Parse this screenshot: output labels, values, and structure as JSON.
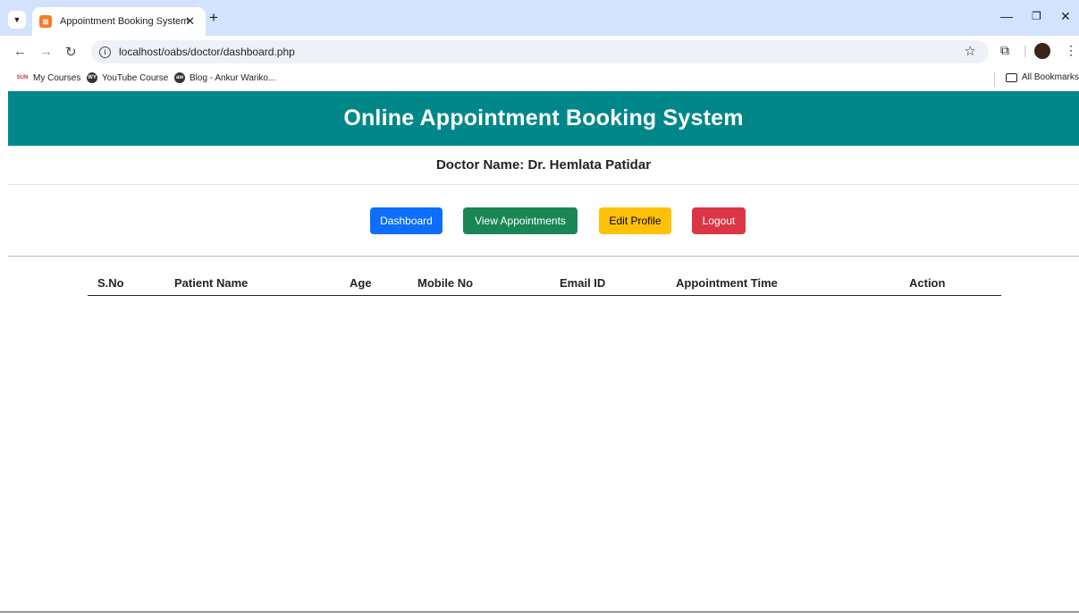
{
  "browser": {
    "tab_title": "Appointment Booking System",
    "tab_close": "✕",
    "new_tab": "+",
    "url": "localhost/oabs/doctor/dashboard.php",
    "bookmarks": [
      {
        "label": "My Courses",
        "icon": "SUN"
      },
      {
        "label": "YouTube Course",
        "icon": "WY"
      },
      {
        "label": "Blog - Ankur Wariko...",
        "icon": "aw"
      }
    ],
    "all_bookmarks": "All Bookmarks"
  },
  "header": {
    "title": "Online Appointment Booking System"
  },
  "doctor": {
    "label": "Doctor Name: Dr. Hemlata Patidar"
  },
  "nav": {
    "dashboard": "Dashboard",
    "view_appointments": "View Appointments",
    "edit_profile": "Edit Profile",
    "logout": "Logout"
  },
  "table": {
    "columns": [
      "S.No",
      "Patient Name",
      "Age",
      "Mobile No",
      "Email ID",
      "Appointment Time",
      "Action"
    ]
  },
  "colors": {
    "header_bg": "#00878a",
    "primary": "#0d6efd",
    "success": "#198754",
    "warning": "#ffc107",
    "danger": "#dc3545"
  }
}
